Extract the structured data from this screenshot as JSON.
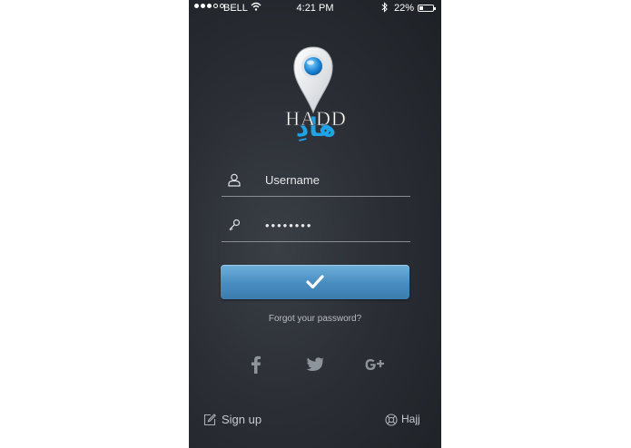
{
  "status_bar": {
    "carrier": "BELL",
    "time": "4:21 PM",
    "battery_percent": "22%",
    "signal_bars_filled": 3,
    "signal_bars_total": 5
  },
  "logo": {
    "icon": "map-pin-icon",
    "latin_text": "HADD",
    "arabic_text": "هادِ",
    "accent_color": "#1fa3e6"
  },
  "login_form": {
    "username": {
      "icon": "user-icon",
      "placeholder": "Username",
      "value": ""
    },
    "password": {
      "icon": "key-icon",
      "masked_value": "••••••••"
    },
    "submit_icon": "checkmark-icon"
  },
  "forgot_password_label": "Forgot your password?",
  "social_logins": [
    {
      "icon": "facebook-icon"
    },
    {
      "icon": "twitter-icon"
    },
    {
      "icon": "google-plus-icon"
    }
  ],
  "footer": {
    "signup": {
      "icon": "edit-icon",
      "label": "Sign up"
    },
    "hajj": {
      "icon": "lifebuoy-icon",
      "label": "Hajj"
    }
  }
}
